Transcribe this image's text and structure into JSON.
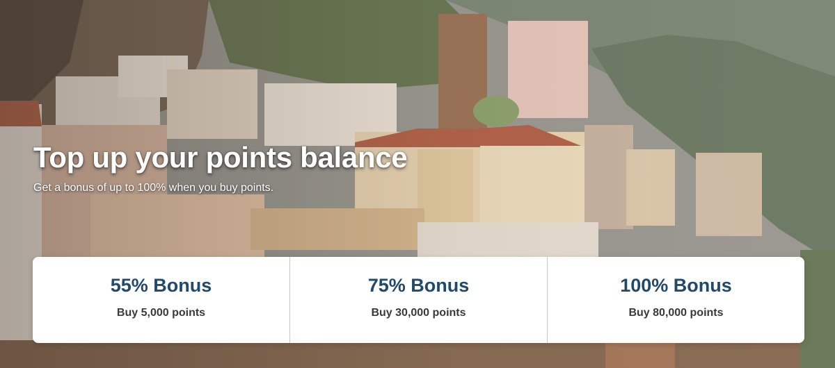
{
  "hero": {
    "title": "Top up your points balance",
    "subtitle": "Get a bonus of up to 100% when you buy points."
  },
  "offers": [
    {
      "bonus": "55% Bonus",
      "buy": "Buy 5,000 points"
    },
    {
      "bonus": "75% Bonus",
      "buy": "Buy 30,000 points"
    },
    {
      "bonus": "100% Bonus",
      "buy": "Buy 80,000 points"
    }
  ],
  "colors": {
    "bonus_text": "#21496b",
    "buy_text": "#3a3a3a",
    "card_bg": "#ffffff"
  }
}
